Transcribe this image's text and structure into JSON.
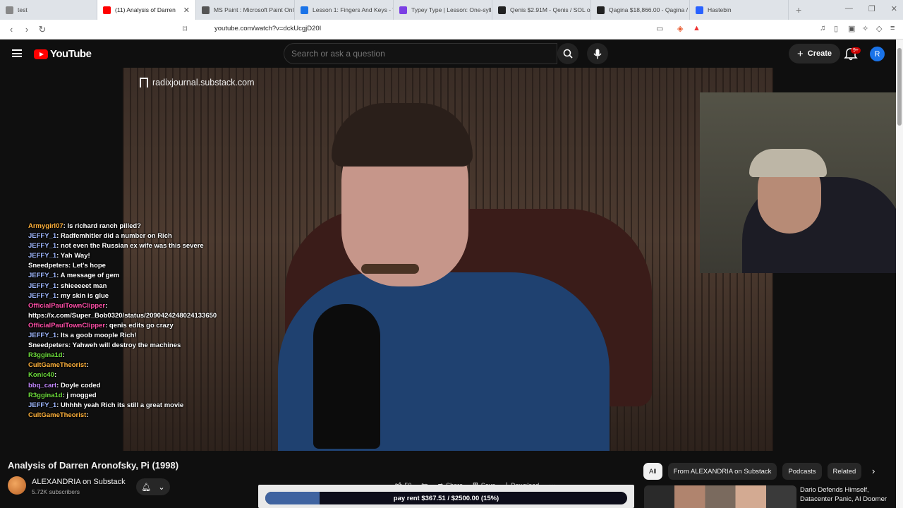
{
  "browser": {
    "tabs": [
      {
        "title": "test",
        "color": "#888888",
        "active": false
      },
      {
        "title": "(11) Analysis of Darren",
        "color": "#ff0000",
        "active": true
      },
      {
        "title": "MS Paint : Microsoft Paint Onl",
        "color": "#555555",
        "active": false
      },
      {
        "title": "Lesson 1: Fingers And Keys - T",
        "color": "#1a73e8",
        "active": false
      },
      {
        "title": "Typey Type | Lesson: One-sylla",
        "color": "#7b3fe4",
        "active": false
      },
      {
        "title": "Qenis $2.91M - Qenis / SOL o",
        "color": "#222222",
        "active": false
      },
      {
        "title": "Qagina $18,866.00 - Qagina /",
        "color": "#222222",
        "active": false
      },
      {
        "title": "Hastebin",
        "color": "#2962ff",
        "active": false
      }
    ],
    "url": "youtube.com/watch?v=dckUcgjD20I"
  },
  "header": {
    "logo_text": "YouTube",
    "search_placeholder": "Search or ask a question",
    "create_label": "Create",
    "notification_badge": "9+",
    "avatar_letter": "R"
  },
  "video": {
    "watermark": "radixjournal.substack.com",
    "chat": [
      {
        "user": "Armygirl07",
        "msg": "Is richard ranch pilled?",
        "color": "u-orange"
      },
      {
        "user": "JEFFY_1",
        "msg": "Radfemhitler did a number on Rich",
        "color": "u-blue"
      },
      {
        "user": "JEFFY_1",
        "msg": "not even the Russian ex wife was this severe",
        "color": "u-blue"
      },
      {
        "user": "JEFFY_1",
        "msg": "Yah Way!",
        "color": "u-blue"
      },
      {
        "user": "Sneedpeters",
        "msg": "Let's hope",
        "color": "u-white"
      },
      {
        "user": "JEFFY_1",
        "msg": "A message of gem",
        "color": "u-blue"
      },
      {
        "user": "JEFFY_1",
        "msg": "shieeeeet man",
        "color": "u-blue"
      },
      {
        "user": "JEFFY_1",
        "msg": "my skin is glue",
        "color": "u-blue"
      },
      {
        "user": "OfficialPaulTownClipper",
        "msg": "",
        "color": "u-pink"
      },
      {
        "user": "",
        "msg": "https://x.com/Super_Bob0320/status/2090424248024133650",
        "color": "u-white"
      },
      {
        "user": "OfficialPaulTownClipper",
        "msg": "qenis edits go crazy",
        "color": "u-pink"
      },
      {
        "user": "JEFFY_1",
        "msg": "Its a goob moople Rich!",
        "color": "u-blue"
      },
      {
        "user": "Sneedpeters",
        "msg": "Yahweh will destroy the machines",
        "color": "u-white"
      },
      {
        "user": "R3ggina1d",
        "msg": "",
        "color": "u-green"
      },
      {
        "user": "CultGameTheorist",
        "msg": "",
        "color": "u-orange"
      },
      {
        "user": "Konic40",
        "msg": "",
        "color": "u-green"
      },
      {
        "user": "bbq_cart",
        "msg": "Doyle coded",
        "color": "u-purple"
      },
      {
        "user": "R3ggina1d",
        "msg": "j mogged",
        "color": "u-green"
      },
      {
        "user": "JEFFY_1",
        "msg": "Uhhhh yeah Rich its still a great movie",
        "color": "u-blue"
      },
      {
        "user": "CultGameTheorist",
        "msg": "",
        "color": "u-orange"
      }
    ]
  },
  "below": {
    "title": "Analysis of Darren Aronofsky, Pi (1998)",
    "channel": "ALEXANDRIA on Substack",
    "subscribers": "5.72K subscribers",
    "likes": "50",
    "share": "Share",
    "save": "Save",
    "download": "Download",
    "rent_text": "pay rent $367.51 / $2500.00 (15%)",
    "rent_progress": 0.15,
    "chips": [
      "All",
      "From ALEXANDRIA on Substack",
      "Podcasts",
      "Related"
    ],
    "related_title": "Dario Defends Himself, Datacenter Panic, AI Doomer"
  }
}
